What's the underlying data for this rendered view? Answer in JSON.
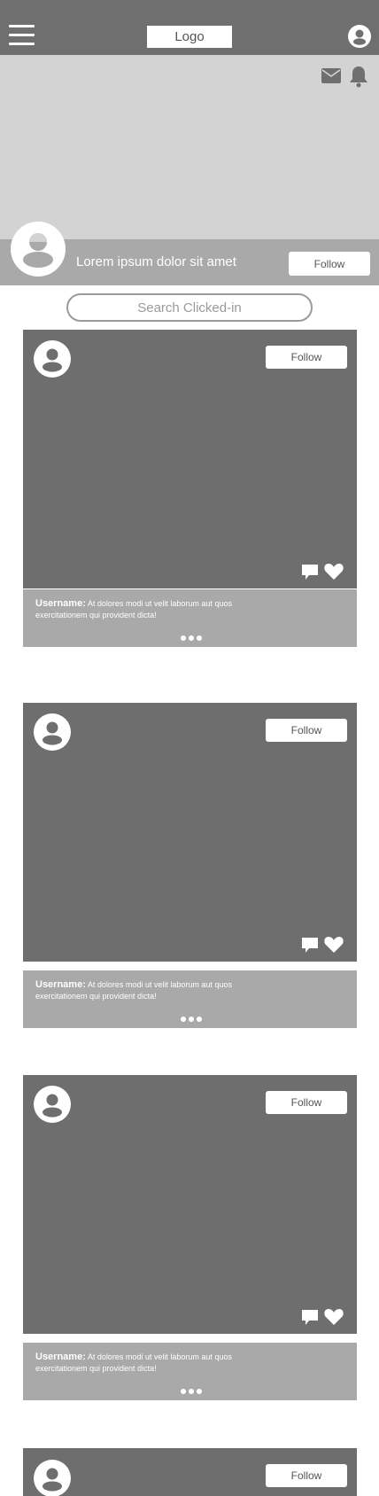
{
  "header": {
    "logo_label": "Logo",
    "menu_icon": "hamburger-menu-icon",
    "account_icon": "user-circle-icon"
  },
  "cover": {
    "mail_icon": "mail-icon",
    "bell_icon": "bell-icon"
  },
  "profile": {
    "name": "Lorem ipsum dolor sit amet",
    "follow_label": "Follow"
  },
  "search": {
    "placeholder": "Search Clicked-in"
  },
  "posts": [
    {
      "follow_label": "Follow",
      "username": "Username:",
      "caption_line1": "At dolores modi ut velit laborum aut quos",
      "caption_line2": "exercitationem qui provident dicta!"
    },
    {
      "follow_label": "Follow",
      "username": "Username:",
      "caption_line1": "At dolores modi ut velit laborum aut quos",
      "caption_line2": "exercitationem qui provident dicta!"
    },
    {
      "follow_label": "Follow",
      "username": "Username:",
      "caption_line1": "At dolores modi ut velit laborum aut quos",
      "caption_line2": "exercitationem qui provident dicta!"
    },
    {
      "follow_label": "Follow"
    }
  ],
  "colors": {
    "topbar": "#6f6f6f",
    "cover": "#d3d3d3",
    "band": "#a9a9a9",
    "media": "#6e6e6e",
    "white": "#ffffff"
  }
}
